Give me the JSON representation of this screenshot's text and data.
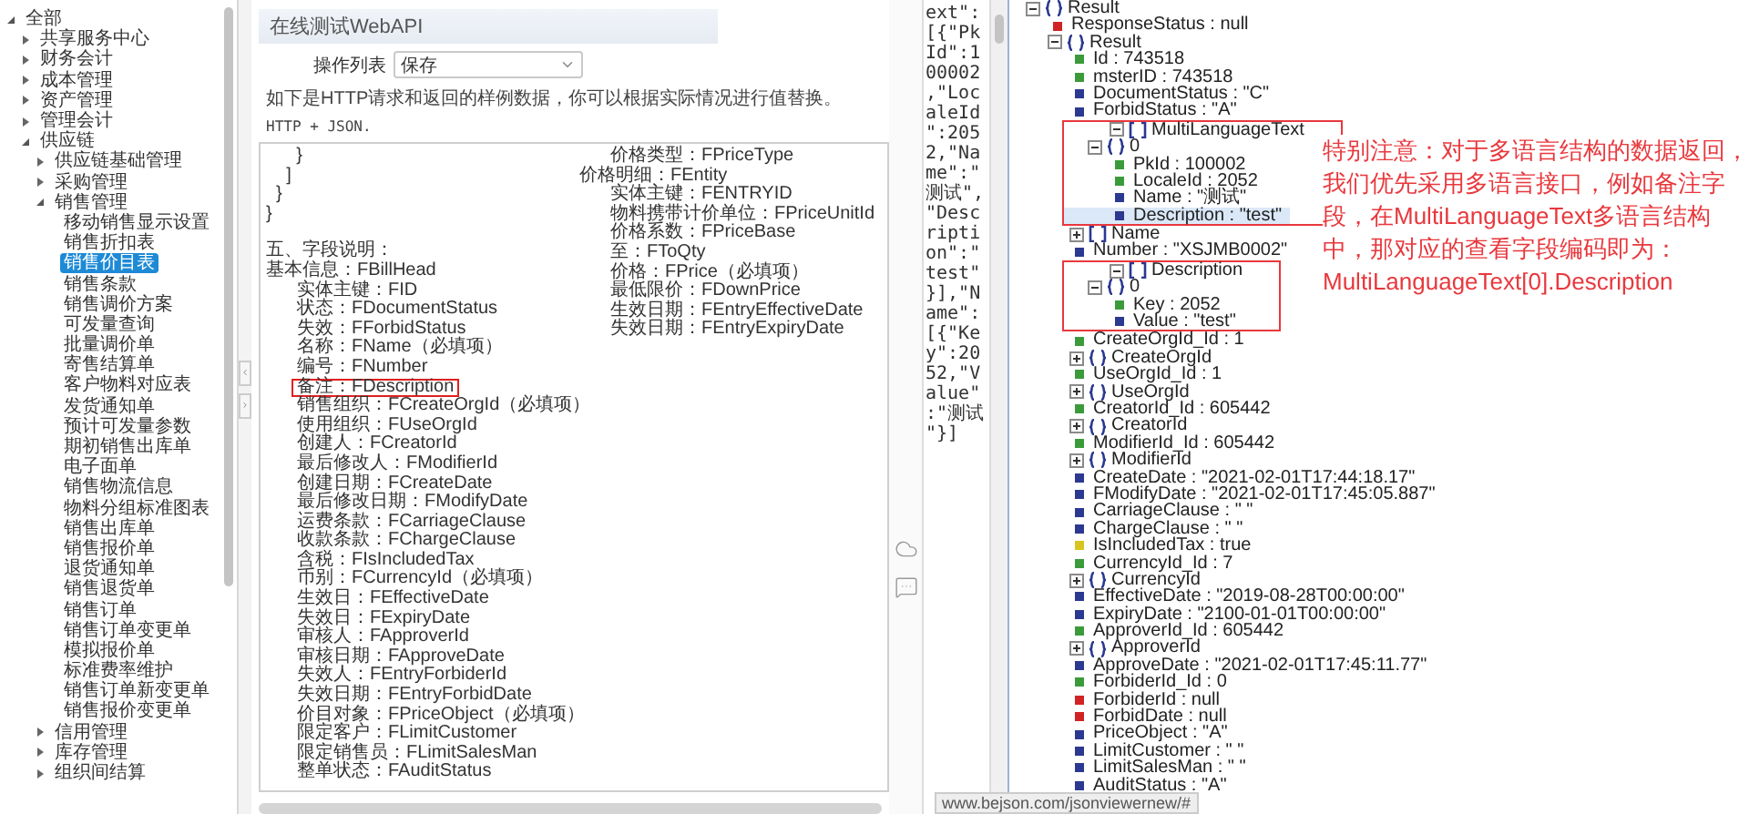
{
  "nav_tree": [
    {
      "label": "全部",
      "kind": "folder",
      "expanded": true,
      "selected": false,
      "children": [
        {
          "label": "共享服务中心",
          "kind": "folder",
          "expanded": false,
          "selected": false
        },
        {
          "label": "财务会计",
          "kind": "folder",
          "expanded": false,
          "selected": false
        },
        {
          "label": "成本管理",
          "kind": "folder",
          "expanded": false,
          "selected": false
        },
        {
          "label": "资产管理",
          "kind": "folder",
          "expanded": false,
          "selected": false
        },
        {
          "label": "管理会计",
          "kind": "folder",
          "expanded": false,
          "selected": false
        },
        {
          "label": "供应链",
          "kind": "folder",
          "expanded": true,
          "selected": false,
          "children": [
            {
              "label": "供应链基础管理",
              "kind": "folder",
              "expanded": false,
              "selected": false
            },
            {
              "label": "采购管理",
              "kind": "folder",
              "expanded": false,
              "selected": false
            },
            {
              "label": "销售管理",
              "kind": "folder",
              "expanded": true,
              "selected": false,
              "children": [
                {
                  "label": "移动销售显示设置",
                  "kind": "leaf",
                  "selected": false
                },
                {
                  "label": "销售折扣表",
                  "kind": "leaf",
                  "selected": false
                },
                {
                  "label": "销售价目表",
                  "kind": "leaf",
                  "selected": true
                },
                {
                  "label": "销售条款",
                  "kind": "leaf",
                  "selected": false
                },
                {
                  "label": "销售调价方案",
                  "kind": "leaf",
                  "selected": false
                },
                {
                  "label": "可发量查询",
                  "kind": "leaf",
                  "selected": false
                },
                {
                  "label": "批量调价单",
                  "kind": "leaf",
                  "selected": false
                },
                {
                  "label": "寄售结算单",
                  "kind": "leaf",
                  "selected": false
                },
                {
                  "label": "客户物料对应表",
                  "kind": "leaf",
                  "selected": false
                },
                {
                  "label": "发货通知单",
                  "kind": "leaf",
                  "selected": false
                },
                {
                  "label": "预计可发量参数",
                  "kind": "leaf",
                  "selected": false
                },
                {
                  "label": "期初销售出库单",
                  "kind": "leaf",
                  "selected": false
                },
                {
                  "label": "电子面单",
                  "kind": "leaf",
                  "selected": false
                },
                {
                  "label": "销售物流信息",
                  "kind": "leaf",
                  "selected": false
                },
                {
                  "label": "物料分组标准图表",
                  "kind": "leaf",
                  "selected": false
                },
                {
                  "label": "销售出库单",
                  "kind": "leaf",
                  "selected": false
                },
                {
                  "label": "销售报价单",
                  "kind": "leaf",
                  "selected": false
                },
                {
                  "label": "退货通知单",
                  "kind": "leaf",
                  "selected": false
                },
                {
                  "label": "销售退货单",
                  "kind": "leaf",
                  "selected": false
                },
                {
                  "label": "销售订单",
                  "kind": "leaf",
                  "selected": false
                },
                {
                  "label": "销售订单变更单",
                  "kind": "leaf",
                  "selected": false
                },
                {
                  "label": "模拟报价单",
                  "kind": "leaf",
                  "selected": false
                },
                {
                  "label": "标准费率维护",
                  "kind": "leaf",
                  "selected": false
                },
                {
                  "label": "销售订单新变更单",
                  "kind": "leaf",
                  "selected": false
                },
                {
                  "label": "销售报价变更单",
                  "kind": "leaf",
                  "selected": false
                }
              ]
            },
            {
              "label": "信用管理",
              "kind": "folder",
              "expanded": false,
              "selected": false
            },
            {
              "label": "库存管理",
              "kind": "folder",
              "expanded": false,
              "selected": false
            },
            {
              "label": "组织间结算",
              "kind": "folder",
              "expanded": false,
              "selected": false
            }
          ]
        }
      ]
    }
  ],
  "api_panel": {
    "title": "在线测试WebAPI",
    "operation_label": "操作列表",
    "operation_value": "保存",
    "note": "如下是HTTP请求和返回的样例数据，你可以根据实际情况进行值替换。",
    "note_format": "HTTP + JSON.",
    "code_lines": [
      "      }",
      "    ]",
      "  }",
      "}"
    ],
    "heading": "五、字段说明：",
    "field_sections": [
      {
        "label": "基本信息：FBillHead",
        "children": [
          {
            "label": "实体主键：FID",
            "highlighted": false
          },
          {
            "label": "状态：FDocumentStatus",
            "highlighted": false
          },
          {
            "label": "失效：FForbidStatus",
            "highlighted": false
          },
          {
            "label": "名称：FName（必填项）",
            "highlighted": false
          },
          {
            "label": "编号：FNumber",
            "highlighted": false
          },
          {
            "label": "备注：FDescription",
            "highlighted": true
          },
          {
            "label": "销售组织：FCreateOrgId（必填项）",
            "highlighted": false
          },
          {
            "label": "使用组织：FUseOrgId",
            "highlighted": false
          },
          {
            "label": "创建人：FCreatorId",
            "highlighted": false
          },
          {
            "label": "最后修改人：FModifierId",
            "highlighted": false
          },
          {
            "label": "创建日期：FCreateDate",
            "highlighted": false
          },
          {
            "label": "最后修改日期：FModifyDate",
            "highlighted": false
          },
          {
            "label": "运费条款：FCarriageClause",
            "highlighted": false
          },
          {
            "label": "收款条款：FChargeClause",
            "highlighted": false
          },
          {
            "label": "含税：FIsIncludedTax",
            "highlighted": false
          },
          {
            "label": "币别：FCurrencyId（必填项）",
            "highlighted": false
          },
          {
            "label": "生效日：FEffectiveDate",
            "highlighted": false
          },
          {
            "label": "失效日：FExpiryDate",
            "highlighted": false
          },
          {
            "label": "审核人：FApproverId",
            "highlighted": false
          },
          {
            "label": "审核日期：FApproveDate",
            "highlighted": false
          },
          {
            "label": "失效人：FEntryForbiderId",
            "highlighted": false
          },
          {
            "label": "失效日期：FEntryForbidDate",
            "highlighted": false
          },
          {
            "label": "价目对象：FPriceObject（必填项）",
            "highlighted": false
          },
          {
            "label": "限定客户：FLimitCustomer",
            "highlighted": false
          },
          {
            "label": "限定销售员：FLimitSalesMan",
            "highlighted": false
          },
          {
            "label": "整单状态：FAuditStatus",
            "highlighted": false
          },
          {
            "label": "价格类型：FPriceType",
            "highlighted": false
          }
        ]
      },
      {
        "label": "价格明细：FEntity",
        "children": [
          {
            "label": "实体主键：FENTRYID",
            "highlighted": false
          },
          {
            "label": "物料携带计价单位：FPriceUnitId",
            "highlighted": false
          },
          {
            "label": "价格系数：FPriceBase",
            "highlighted": false
          },
          {
            "label": "至：FToQty",
            "highlighted": false
          },
          {
            "label": "价格：FPrice（必填项）",
            "highlighted": false
          },
          {
            "label": "最低限价：FDownPrice",
            "highlighted": false
          },
          {
            "label": "生效日期：FEntryEffectiveDate",
            "highlighted": false
          },
          {
            "label": "失效日期：FEntryExpiryDate",
            "highlighted": false
          }
        ]
      }
    ]
  },
  "raw_json_text": "ext\":[{\"PkId\":100002,\"LocaleId\":2052,\"Name\":\"测试\",\"Description\":\"test\"}],\"Name\":[{\"Key\":2052,\"Value\":\"测试\"}]",
  "json_tree": [
    {
      "label": "Result",
      "kind": "object",
      "expanded": true,
      "selected": false,
      "children": [
        {
          "label": "ResponseStatus : null",
          "kind": "null",
          "selected": false
        },
        {
          "label": "Result",
          "kind": "object",
          "expanded": true,
          "selected": false,
          "children": [
            {
              "label": "Id : 743518",
              "kind": "number",
              "selected": false
            },
            {
              "label": "msterID : 743518",
              "kind": "number",
              "selected": false
            },
            {
              "label": "DocumentStatus : \"C\"",
              "kind": "string",
              "selected": false
            },
            {
              "label": "ForbidStatus : \"A\"",
              "kind": "string",
              "selected": false
            },
            {
              "label": "MultiLanguageText",
              "kind": "array",
              "expanded": true,
              "selected": false,
              "highlighted": true,
              "children": [
                {
                  "label": "0",
                  "kind": "object",
                  "expanded": true,
                  "selected": false,
                  "children": [
                    {
                      "label": "PkId : 100002",
                      "kind": "number",
                      "selected": false
                    },
                    {
                      "label": "LocaleId : 2052",
                      "kind": "number",
                      "selected": false
                    },
                    {
                      "label": "Name : \"测试\"",
                      "kind": "string",
                      "selected": false
                    },
                    {
                      "label": "Description : \"test\"",
                      "kind": "string",
                      "selected": true
                    }
                  ]
                }
              ]
            },
            {
              "label": "Name",
              "kind": "array",
              "expanded": false,
              "selected": false
            },
            {
              "label": "Number : \"XSJMB0002\"",
              "kind": "string",
              "selected": false
            },
            {
              "label": "Description",
              "kind": "array",
              "expanded": true,
              "selected": false,
              "highlighted": true,
              "children": [
                {
                  "label": "0",
                  "kind": "object",
                  "expanded": true,
                  "selected": false,
                  "children": [
                    {
                      "label": "Key : 2052",
                      "kind": "number",
                      "selected": false
                    },
                    {
                      "label": "Value : \"test\"",
                      "kind": "string",
                      "selected": false
                    }
                  ]
                }
              ]
            },
            {
              "label": "CreateOrgId_Id : 1",
              "kind": "number",
              "selected": false
            },
            {
              "label": "CreateOrgId",
              "kind": "object",
              "expanded": false,
              "selected": false
            },
            {
              "label": "UseOrgId_Id : 1",
              "kind": "number",
              "selected": false
            },
            {
              "label": "UseOrgId",
              "kind": "object",
              "expanded": false,
              "selected": false
            },
            {
              "label": "CreatorId_Id : 605442",
              "kind": "number",
              "selected": false
            },
            {
              "label": "CreatorId",
              "kind": "object",
              "expanded": false,
              "selected": false
            },
            {
              "label": "ModifierId_Id : 605442",
              "kind": "number",
              "selected": false
            },
            {
              "label": "ModifierId",
              "kind": "object",
              "expanded": false,
              "selected": false
            },
            {
              "label": "CreateDate : \"2021-02-01T17:44:18.17\"",
              "kind": "string",
              "selected": false
            },
            {
              "label": "FModifyDate : \"2021-02-01T17:45:05.887\"",
              "kind": "string",
              "selected": false
            },
            {
              "label": "CarriageClause : \" \"",
              "kind": "string",
              "selected": false
            },
            {
              "label": "ChargeClause : \" \"",
              "kind": "string",
              "selected": false
            },
            {
              "label": "IsIncludedTax : true",
              "kind": "boolean",
              "selected": false
            },
            {
              "label": "CurrencyId_Id : 7",
              "kind": "number",
              "selected": false
            },
            {
              "label": "CurrencyId",
              "kind": "object",
              "expanded": false,
              "selected": false
            },
            {
              "label": "EffectiveDate : \"2019-08-28T00:00:00\"",
              "kind": "string",
              "selected": false
            },
            {
              "label": "ExpiryDate : \"2100-01-01T00:00:00\"",
              "kind": "string",
              "selected": false
            },
            {
              "label": "ApproverId_Id : 605442",
              "kind": "number",
              "selected": false
            },
            {
              "label": "ApproverId",
              "kind": "object",
              "expanded": false,
              "selected": false
            },
            {
              "label": "ApproveDate : \"2021-02-01T17:45:11.77\"",
              "kind": "string",
              "selected": false
            },
            {
              "label": "ForbiderId_Id : 0",
              "kind": "number",
              "selected": false
            },
            {
              "label": "ForbiderId : null",
              "kind": "null",
              "selected": false
            },
            {
              "label": "ForbidDate : null",
              "kind": "null",
              "selected": false
            },
            {
              "label": "PriceObject : \"A\"",
              "kind": "string",
              "selected": false
            },
            {
              "label": "LimitCustomer : \" \"",
              "kind": "string",
              "selected": false
            },
            {
              "label": "LimitSalesMan : \" \"",
              "kind": "string",
              "selected": false
            },
            {
              "label": "AuditStatus : \"A\"",
              "kind": "string",
              "selected": false
            }
          ]
        }
      ]
    }
  ],
  "annotation": "特别注意：对于多语言结构的数据返回，我们优先采用多语言接口，例如备注字段，在MultiLanguageText多语言结构中，那对应的查看字段编码即为：MultiLanguageText[0].Description",
  "status_url": "www.bejson.com/jsonviewernew/#"
}
